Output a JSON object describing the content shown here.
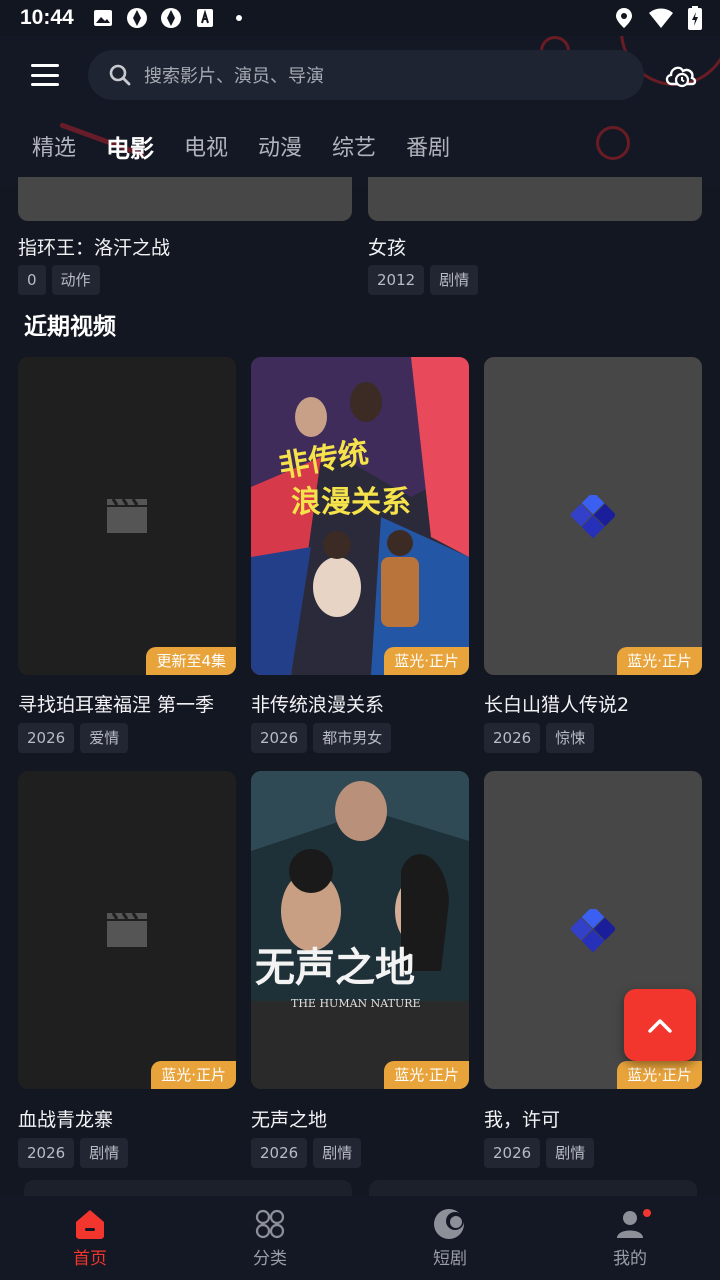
{
  "status": {
    "time": "10:44"
  },
  "search": {
    "placeholder": "搜索影片、演员、导演"
  },
  "tabs": [
    {
      "label": "精选"
    },
    {
      "label": "电影"
    },
    {
      "label": "电视"
    },
    {
      "label": "动漫"
    },
    {
      "label": "综艺"
    },
    {
      "label": "番剧"
    }
  ],
  "active_tab": "电影",
  "top_row": [
    {
      "title": "指环王：洛汗之战",
      "tags": [
        "0",
        "动作"
      ]
    },
    {
      "title": "女孩",
      "tags": [
        "2012",
        "剧情"
      ]
    }
  ],
  "section": {
    "title": "近期视频"
  },
  "videos": [
    {
      "title": "寻找珀耳塞福涅 第一季",
      "badge": "更新至4集",
      "year": "2026",
      "genre": "爱情",
      "poster": "clapper-placeholder"
    },
    {
      "title": "非传统浪漫关系",
      "badge": "蓝光·正片",
      "year": "2026",
      "genre": "都市男女",
      "poster": "image"
    },
    {
      "title": "长白山猎人传说2",
      "badge": "蓝光·正片",
      "year": "2026",
      "genre": "惊悚",
      "poster": "loading-cubes"
    },
    {
      "title": "血战青龙寨",
      "badge": "蓝光·正片",
      "year": "2026",
      "genre": "剧情",
      "poster": "clapper-placeholder"
    },
    {
      "title": "无声之地",
      "badge": "蓝光·正片",
      "year": "2026",
      "genre": "剧情",
      "poster": "image"
    },
    {
      "title": "我，许可",
      "badge": "蓝光·正片",
      "year": "2026",
      "genre": "剧情",
      "poster": "loading-cubes"
    }
  ],
  "bottom_nav": [
    {
      "label": "首页",
      "icon": "home-icon"
    },
    {
      "label": "分类",
      "icon": "grid-icon"
    },
    {
      "label": "短剧",
      "icon": "shorts-icon"
    },
    {
      "label": "我的",
      "icon": "profile-icon"
    }
  ],
  "colors": {
    "accent": "#f2362d",
    "badge": "#e8a33b",
    "background": "#131722"
  }
}
